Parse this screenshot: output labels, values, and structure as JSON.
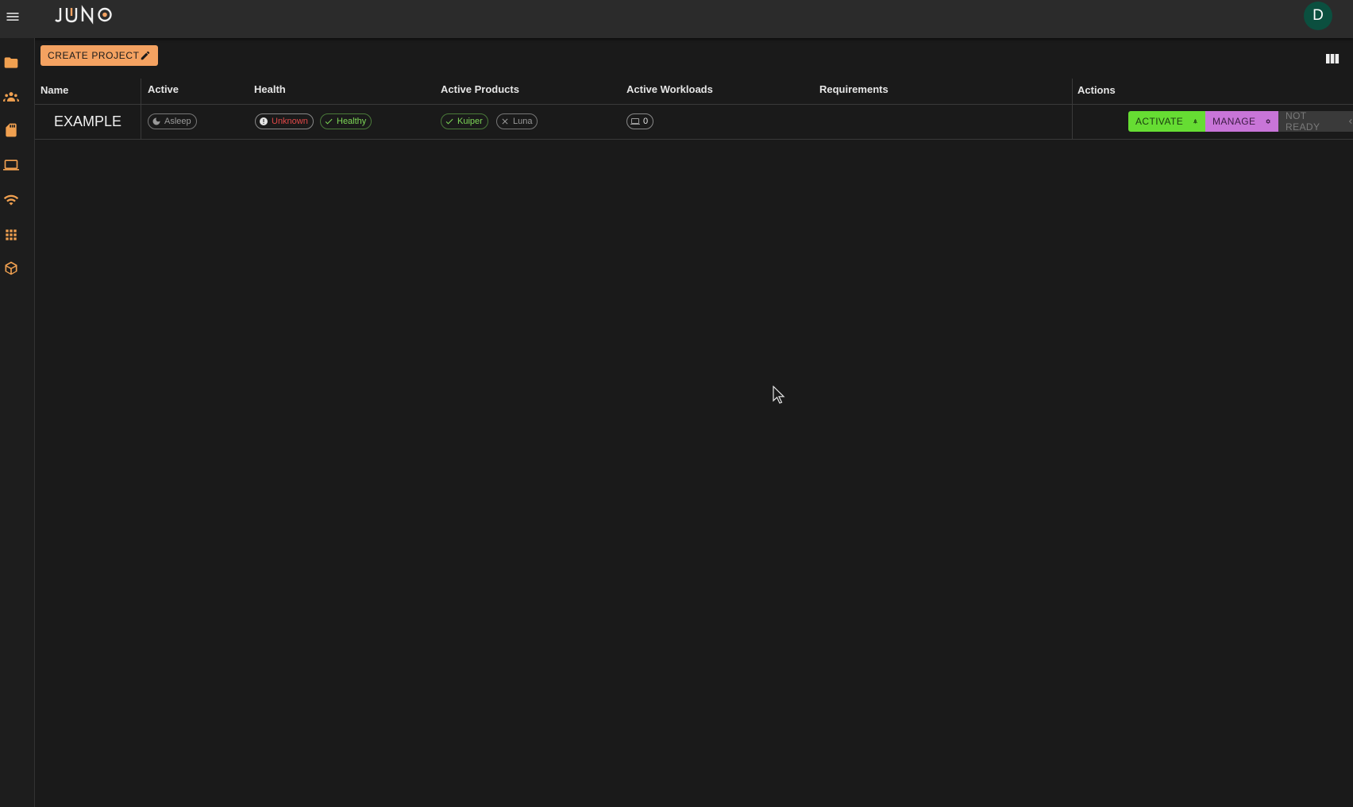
{
  "app": {
    "brand": "JUNO",
    "avatar_initial": "D"
  },
  "sidebar": {
    "items": [
      {
        "icon": "folder-icon"
      },
      {
        "icon": "groups-icon"
      },
      {
        "icon": "sd-card-icon"
      },
      {
        "icon": "laptop-icon"
      },
      {
        "icon": "wifi-icon"
      },
      {
        "icon": "apps-grid-icon"
      },
      {
        "icon": "package-icon"
      }
    ]
  },
  "toolbar": {
    "create_label": "CREATE PROJECT"
  },
  "table": {
    "headers": {
      "name": "Name",
      "active": "Active",
      "health": "Health",
      "products": "Active Products",
      "workloads": "Active Workloads",
      "requirements": "Requirements",
      "actions": "Actions"
    },
    "rows": [
      {
        "name": "EXAMPLE",
        "active": "Asleep",
        "health_unknown": "Unknown",
        "health_healthy": "Healthy",
        "product_kuiper": "Kuiper",
        "product_luna": "Luna",
        "workloads": "0",
        "requirements": "",
        "activate_label": "ACTIVATE",
        "manage_label": "MANAGE",
        "notready_label": "NOT READY"
      }
    ]
  },
  "colors": {
    "accent": "#f4a261",
    "activate": "#66dd33",
    "manage": "#c875d8",
    "avatar": "#0b4f3f"
  }
}
